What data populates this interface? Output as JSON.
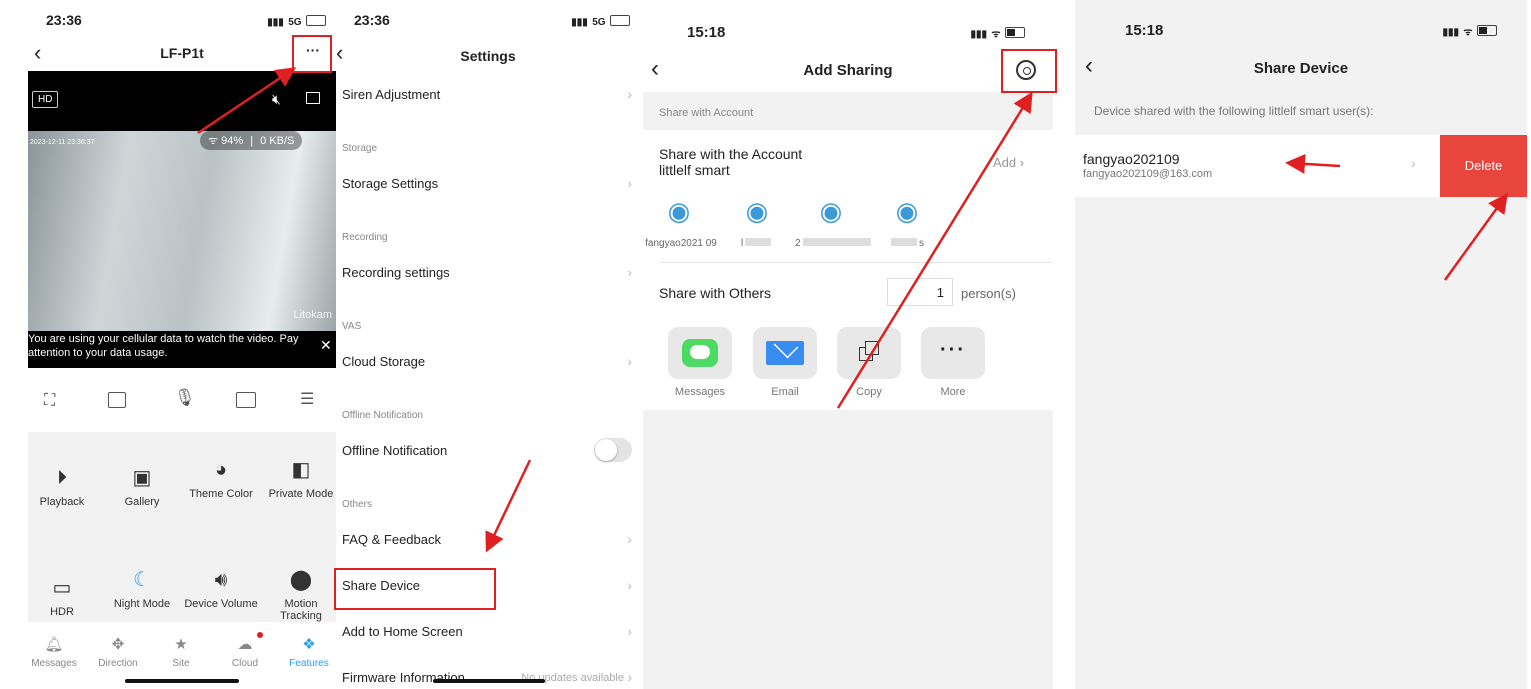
{
  "panel1": {
    "time": "23:36",
    "network": "5G",
    "title": "LF-P1t",
    "more_label": "···",
    "hd_label": "HD",
    "wifi_strength": "94%",
    "speed": "0 KB/S",
    "timestamp": "2023-12-11  23:36:37",
    "watermark": "Litokam",
    "cellular_notice": "You are using your cellular data to watch the video. Pay attention to your data usage.",
    "features": [
      {
        "label": "Playback",
        "icon": "play-icon"
      },
      {
        "label": "Gallery",
        "icon": "image-icon"
      },
      {
        "label": "Theme Color",
        "icon": "palette-icon"
      },
      {
        "label": "Private Mode",
        "icon": "shield-icon"
      },
      {
        "label": "HDR",
        "icon": "hdr-icon"
      },
      {
        "label": "Night Mode",
        "icon": "night-icon"
      },
      {
        "label": "Device Volume",
        "icon": "speaker-icon"
      },
      {
        "label": "Motion Tracking",
        "icon": "location-icon"
      }
    ],
    "tabs": [
      {
        "label": "Messages",
        "icon": "bell-icon"
      },
      {
        "label": "Direction",
        "icon": "joystick-icon"
      },
      {
        "label": "Site",
        "icon": "star-icon"
      },
      {
        "label": "Cloud",
        "icon": "cloud-icon"
      },
      {
        "label": "Features",
        "icon": "features-icon"
      }
    ]
  },
  "panel2": {
    "time": "23:36",
    "network": "5G",
    "title": "Settings",
    "rows": {
      "siren": "Siren Adjustment",
      "storage_hdr": "Storage",
      "storage": "Storage Settings",
      "recording_hdr": "Recording",
      "recording": "Recording settings",
      "vas_hdr": "VAS",
      "cloud": "Cloud Storage",
      "offline_hdr": "Offline Notification",
      "offline": "Offline Notification",
      "others_hdr": "Others",
      "faq": "FAQ & Feedback",
      "share": "Share Device",
      "home": "Add to Home Screen",
      "firmware": "Firmware Information",
      "firmware_status": "No updates available"
    },
    "offline_toggle_on": false
  },
  "panel3": {
    "time": "15:18",
    "title": "Add Sharing",
    "share_with_account_hdr": "Share with Account",
    "account_line1": "Share with the Account",
    "account_line2": "littlelf smart",
    "add_label": "Add",
    "avatars": [
      {
        "label": "fangyao2021 09"
      },
      {
        "label": "l"
      },
      {
        "label": "2"
      },
      {
        "label": "s"
      }
    ],
    "share_with_others": "Share with Others",
    "person_count": "1",
    "person_unit": "person(s)",
    "share_options": [
      {
        "label": "Messages",
        "icon": "message-icon",
        "color": "#4cd964"
      },
      {
        "label": "Email",
        "icon": "mail-icon",
        "color": "#3a8df0"
      },
      {
        "label": "Copy",
        "icon": "copy-icon",
        "color": "#333333"
      },
      {
        "label": "More",
        "icon": "more-icon",
        "color": "#333333"
      }
    ]
  },
  "panel4": {
    "time": "15:18",
    "title": "Share Device",
    "notice": "Device shared with the following littlelf smart user(s):",
    "user_name": "fangyao202109",
    "user_email": "fangyao202109@163.com",
    "delete_label": "Delete"
  },
  "colors": {
    "accent": "#e02020",
    "tab_active": "#2a9df4",
    "delete_bg": "#e8453c",
    "avatar_blue": "#3a9ad9"
  }
}
